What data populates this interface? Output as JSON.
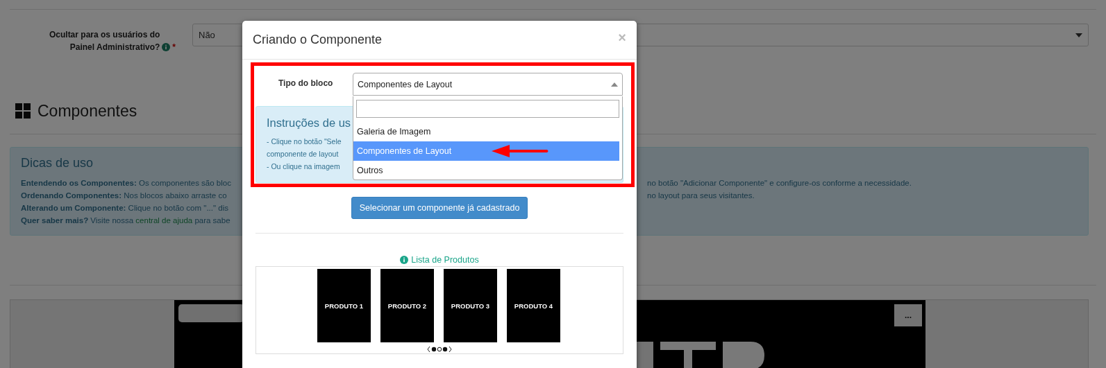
{
  "background": {
    "field": {
      "label": "Ocultar para os usuários do Painel Administrativo?",
      "required_mark": "*",
      "value": "Não"
    },
    "section_title": "Componentes",
    "tips": {
      "title": "Dicas de uso",
      "lines": [
        {
          "text": "**Entendendo os Componentes:** Os componentes são bloc",
          "text_right": "no botão \"Adicionar Componente\" e configure-os conforme a necessidade."
        },
        {
          "text": "**Ordenando Componentes:** Nos blocos abaixo arraste co",
          "text_right": "no layout para seus visitantes."
        },
        {
          "text": "**Alterando um Componente:** Clique no botão com \"...\" dis"
        },
        {
          "text": "**Quer saber mais?** Visite nossa ",
          "link": "central de ajuda",
          "after": " para sabe"
        }
      ]
    },
    "banner_button": "..."
  },
  "modal": {
    "title": "Criando o Componente",
    "close": "×",
    "block_type": {
      "label": "Tipo do bloco",
      "value": "Componentes de Layout",
      "expanded": true,
      "options": [
        {
          "label": "Galeria de Imagem",
          "selected": false
        },
        {
          "label": "Componentes de Layout",
          "selected": true
        },
        {
          "label": "Outros",
          "selected": false
        }
      ]
    },
    "instructions": {
      "title": "Instruções de us",
      "lines": [
        "- Clique no botão \"Sele",
        "componente de layout",
        "- Ou clique na imagem"
      ]
    },
    "select_button": "Selecionar um componente já cadastrado",
    "preview": {
      "title": "Lista de Produtos",
      "products": [
        "PRODUTO 1",
        "PRODUTO 2",
        "PRODUTO 3",
        "PRODUTO 4"
      ]
    }
  }
}
